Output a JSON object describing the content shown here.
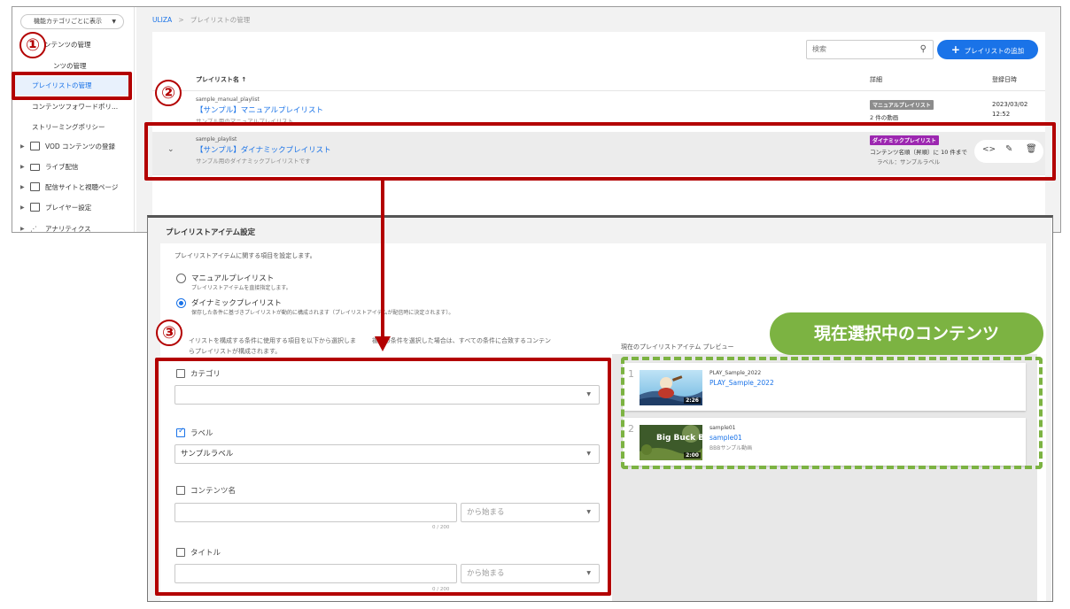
{
  "sidebar": {
    "category_select": "機能カテゴリごとに表示",
    "content_management": "ンテンツの管理",
    "content_management_sub": "ンツの管理",
    "playlist_management": "プレイリストの管理",
    "content_forward_policy": "コンテンツフォワードポリ...",
    "streaming_policy": "ストリーミングポリシー",
    "vod_register": "VOD コンテンツの登録",
    "live": "ライブ配信",
    "site_page": "配信サイトと視聴ページ",
    "player_settings": "プレイヤー設定",
    "analytics": "アナリティクス"
  },
  "breadcrumb": {
    "root": "ULIZA",
    "sep": ">",
    "current": "プレイリストの管理"
  },
  "toolbar": {
    "search_placeholder": "検索",
    "add_button": "プレイリストの追加"
  },
  "table": {
    "headers": {
      "name": "プレイリスト名 ↑",
      "detail": "詳細",
      "date": "登録日時"
    },
    "rows": [
      {
        "id": "sample_manual_playlist",
        "name": "【サンプル】マニュアルプレイリスト",
        "desc": "サンプル用のマニュアルプレイリスト",
        "badge": "マニュアルプレイリスト",
        "badge_color": "#8c8c8c",
        "detail_line1": "2 件の動画",
        "date_line1": "2023/03/02",
        "date_line2": "12:52"
      },
      {
        "id": "sample_playlist",
        "name": "【サンプル】ダイナミックプレイリスト",
        "desc": "サンプル用のダイナミックプレイリストです",
        "badge": "ダイナミックプレイリスト",
        "badge_color": "#9c27b0",
        "detail_line1": "コンテンツ名順（昇順）に 10 件まで",
        "detail_line2": "ラベル：サンプルラベル"
      }
    ]
  },
  "settings": {
    "title": "プレイリストアイテム設定",
    "description": "プレイリストアイテムに関する項目を設定します。",
    "manual": {
      "label": "マニュアルプレイリスト",
      "sub": "プレイリストアイテムを直接指定します。"
    },
    "dynamic": {
      "label": "ダイナミックプレイリスト",
      "sub": "保存した条件に基づきプレイリストが動的に構成されます（プレイリストアイテムが配信時に決定されます）。"
    },
    "condition_desc_line1": "イリストを構成する条件に使用する項目を以下から選択しま",
    "condition_desc_line1b": "複数の条件を選択した場合は、すべての条件に合致するコンテン",
    "condition_desc_line2": "らプレイリストが構成されます。",
    "conditions": {
      "category": {
        "label": "カテゴリ",
        "value": ""
      },
      "label": {
        "label": "ラベル",
        "value": "サンプルラベル"
      },
      "content_name": {
        "label": "コンテンツ名",
        "value": "",
        "match": "から始まる",
        "counter": "0 / 200"
      },
      "title": {
        "label": "タイトル",
        "value": "",
        "match": "から始まる",
        "counter": "0 / 200"
      }
    }
  },
  "preview": {
    "header": "現在のプレイリストアイテム プレビュー",
    "items": [
      {
        "num": "1",
        "id": "PLAY_Sample_2022",
        "title": "PLAY_Sample_2022",
        "desc": "",
        "duration": "2:26"
      },
      {
        "num": "2",
        "id": "sample01",
        "title": "sample01",
        "desc": "BBBサンプル動画",
        "duration": "2:00",
        "thumb_text": "Big Buck BUNNY"
      }
    ]
  },
  "annotations": {
    "n1": "①",
    "n2": "②",
    "n3": "③",
    "callout": "現在選択中のコンテンツ",
    "red": "#b30000",
    "green": "#7cb342"
  }
}
